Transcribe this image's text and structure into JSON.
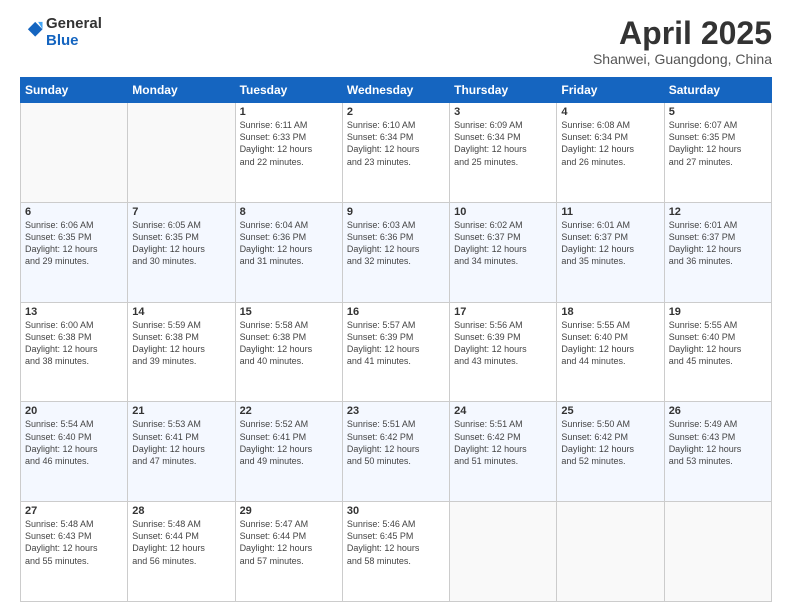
{
  "header": {
    "logo_general": "General",
    "logo_blue": "Blue",
    "month_title": "April 2025",
    "location": "Shanwei, Guangdong, China"
  },
  "weekdays": [
    "Sunday",
    "Monday",
    "Tuesday",
    "Wednesday",
    "Thursday",
    "Friday",
    "Saturday"
  ],
  "rows": [
    [
      {
        "day": "",
        "info": ""
      },
      {
        "day": "",
        "info": ""
      },
      {
        "day": "1",
        "info": "Sunrise: 6:11 AM\nSunset: 6:33 PM\nDaylight: 12 hours\nand 22 minutes."
      },
      {
        "day": "2",
        "info": "Sunrise: 6:10 AM\nSunset: 6:34 PM\nDaylight: 12 hours\nand 23 minutes."
      },
      {
        "day": "3",
        "info": "Sunrise: 6:09 AM\nSunset: 6:34 PM\nDaylight: 12 hours\nand 25 minutes."
      },
      {
        "day": "4",
        "info": "Sunrise: 6:08 AM\nSunset: 6:34 PM\nDaylight: 12 hours\nand 26 minutes."
      },
      {
        "day": "5",
        "info": "Sunrise: 6:07 AM\nSunset: 6:35 PM\nDaylight: 12 hours\nand 27 minutes."
      }
    ],
    [
      {
        "day": "6",
        "info": "Sunrise: 6:06 AM\nSunset: 6:35 PM\nDaylight: 12 hours\nand 29 minutes."
      },
      {
        "day": "7",
        "info": "Sunrise: 6:05 AM\nSunset: 6:35 PM\nDaylight: 12 hours\nand 30 minutes."
      },
      {
        "day": "8",
        "info": "Sunrise: 6:04 AM\nSunset: 6:36 PM\nDaylight: 12 hours\nand 31 minutes."
      },
      {
        "day": "9",
        "info": "Sunrise: 6:03 AM\nSunset: 6:36 PM\nDaylight: 12 hours\nand 32 minutes."
      },
      {
        "day": "10",
        "info": "Sunrise: 6:02 AM\nSunset: 6:37 PM\nDaylight: 12 hours\nand 34 minutes."
      },
      {
        "day": "11",
        "info": "Sunrise: 6:01 AM\nSunset: 6:37 PM\nDaylight: 12 hours\nand 35 minutes."
      },
      {
        "day": "12",
        "info": "Sunrise: 6:01 AM\nSunset: 6:37 PM\nDaylight: 12 hours\nand 36 minutes."
      }
    ],
    [
      {
        "day": "13",
        "info": "Sunrise: 6:00 AM\nSunset: 6:38 PM\nDaylight: 12 hours\nand 38 minutes."
      },
      {
        "day": "14",
        "info": "Sunrise: 5:59 AM\nSunset: 6:38 PM\nDaylight: 12 hours\nand 39 minutes."
      },
      {
        "day": "15",
        "info": "Sunrise: 5:58 AM\nSunset: 6:38 PM\nDaylight: 12 hours\nand 40 minutes."
      },
      {
        "day": "16",
        "info": "Sunrise: 5:57 AM\nSunset: 6:39 PM\nDaylight: 12 hours\nand 41 minutes."
      },
      {
        "day": "17",
        "info": "Sunrise: 5:56 AM\nSunset: 6:39 PM\nDaylight: 12 hours\nand 43 minutes."
      },
      {
        "day": "18",
        "info": "Sunrise: 5:55 AM\nSunset: 6:40 PM\nDaylight: 12 hours\nand 44 minutes."
      },
      {
        "day": "19",
        "info": "Sunrise: 5:55 AM\nSunset: 6:40 PM\nDaylight: 12 hours\nand 45 minutes."
      }
    ],
    [
      {
        "day": "20",
        "info": "Sunrise: 5:54 AM\nSunset: 6:40 PM\nDaylight: 12 hours\nand 46 minutes."
      },
      {
        "day": "21",
        "info": "Sunrise: 5:53 AM\nSunset: 6:41 PM\nDaylight: 12 hours\nand 47 minutes."
      },
      {
        "day": "22",
        "info": "Sunrise: 5:52 AM\nSunset: 6:41 PM\nDaylight: 12 hours\nand 49 minutes."
      },
      {
        "day": "23",
        "info": "Sunrise: 5:51 AM\nSunset: 6:42 PM\nDaylight: 12 hours\nand 50 minutes."
      },
      {
        "day": "24",
        "info": "Sunrise: 5:51 AM\nSunset: 6:42 PM\nDaylight: 12 hours\nand 51 minutes."
      },
      {
        "day": "25",
        "info": "Sunrise: 5:50 AM\nSunset: 6:42 PM\nDaylight: 12 hours\nand 52 minutes."
      },
      {
        "day": "26",
        "info": "Sunrise: 5:49 AM\nSunset: 6:43 PM\nDaylight: 12 hours\nand 53 minutes."
      }
    ],
    [
      {
        "day": "27",
        "info": "Sunrise: 5:48 AM\nSunset: 6:43 PM\nDaylight: 12 hours\nand 55 minutes."
      },
      {
        "day": "28",
        "info": "Sunrise: 5:48 AM\nSunset: 6:44 PM\nDaylight: 12 hours\nand 56 minutes."
      },
      {
        "day": "29",
        "info": "Sunrise: 5:47 AM\nSunset: 6:44 PM\nDaylight: 12 hours\nand 57 minutes."
      },
      {
        "day": "30",
        "info": "Sunrise: 5:46 AM\nSunset: 6:45 PM\nDaylight: 12 hours\nand 58 minutes."
      },
      {
        "day": "",
        "info": ""
      },
      {
        "day": "",
        "info": ""
      },
      {
        "day": "",
        "info": ""
      }
    ]
  ]
}
